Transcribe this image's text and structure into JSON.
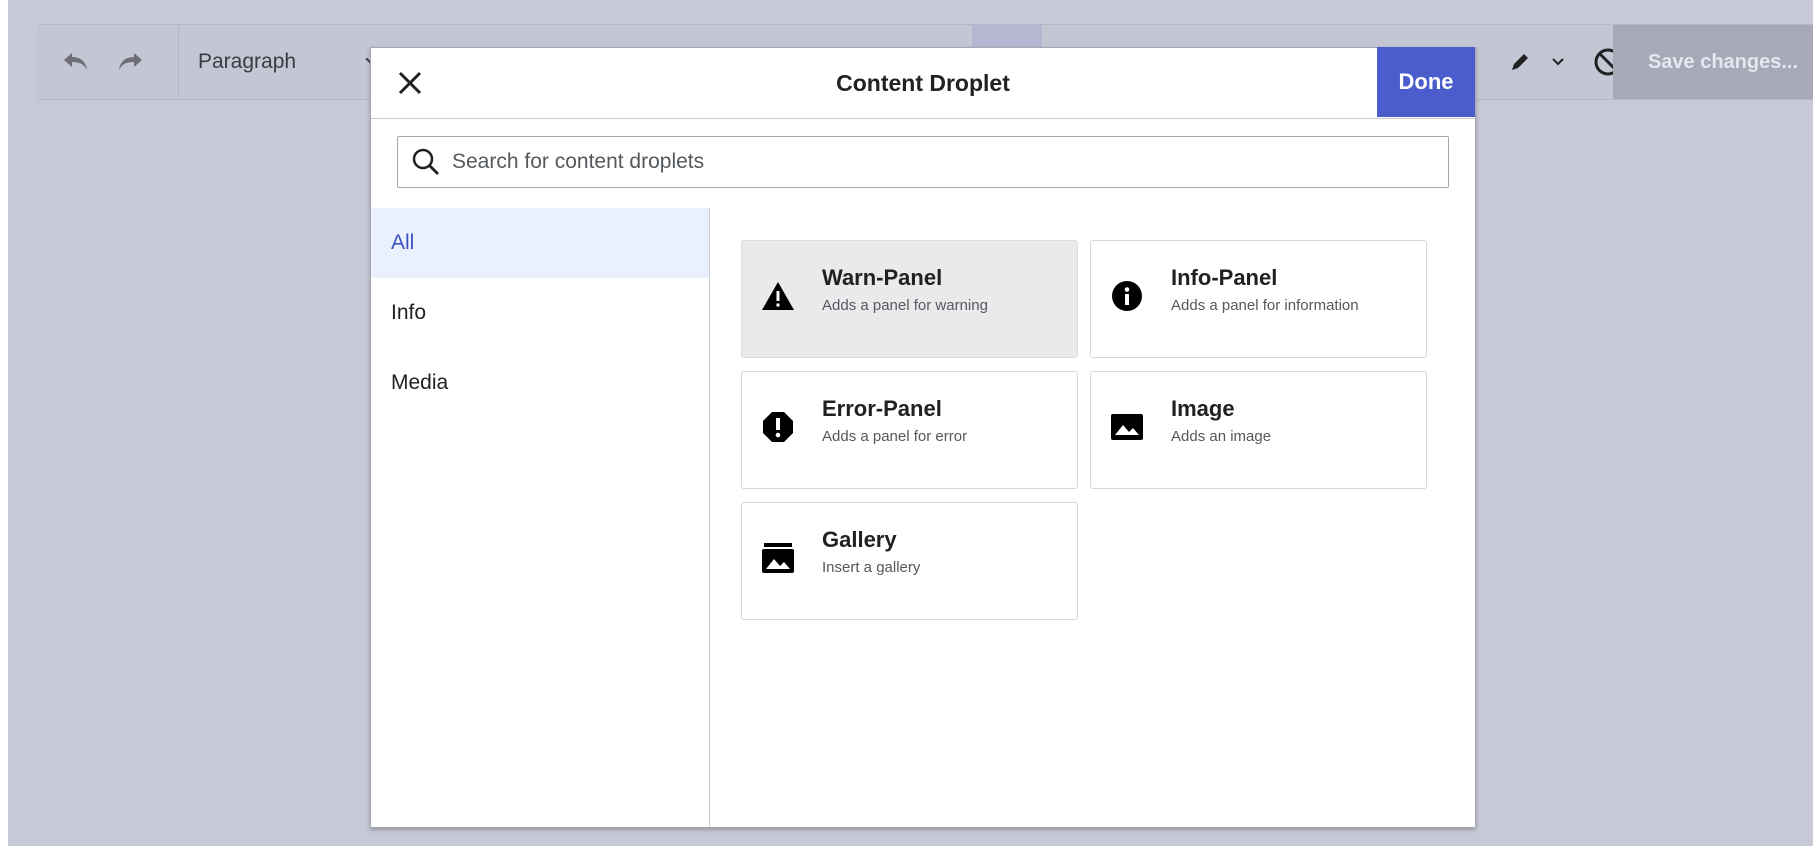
{
  "toolbar": {
    "paragraph_label": "Paragraph",
    "save_label": "Save changes..."
  },
  "dialog": {
    "title": "Content Droplet",
    "done_label": "Done",
    "search_placeholder": "Search for content droplets"
  },
  "categories": [
    {
      "label": "All",
      "active": true
    },
    {
      "label": "Info",
      "active": false
    },
    {
      "label": "Media",
      "active": false
    }
  ],
  "droplets": [
    {
      "title": "Warn-Panel",
      "description": "Adds a panel for warning",
      "icon": "warning-icon",
      "selected": true
    },
    {
      "title": "Info-Panel",
      "description": "Adds a panel for information",
      "icon": "info-icon",
      "selected": false
    },
    {
      "title": "Error-Panel",
      "description": "Adds a panel for error",
      "icon": "error-icon",
      "selected": false
    },
    {
      "title": "Image",
      "description": "Adds an image",
      "icon": "image-icon",
      "selected": false
    },
    {
      "title": "Gallery",
      "description": "Insert a gallery",
      "icon": "gallery-icon",
      "selected": false
    }
  ],
  "colors": {
    "accent": "#4b5ccc",
    "active_category_bg": "#eaf0fd",
    "active_category_text": "#3f51c6",
    "overlay": "#c8c9d7"
  }
}
